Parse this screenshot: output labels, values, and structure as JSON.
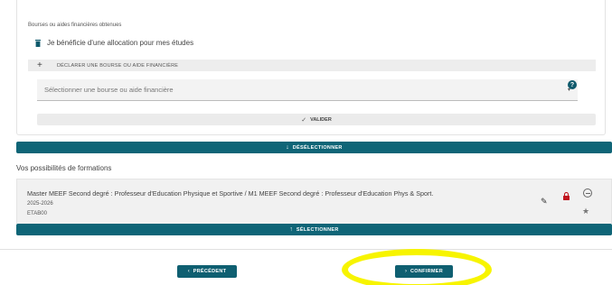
{
  "scholarship": {
    "section_label": "Bourses ou aides financières obtenues",
    "allocation_text": "Je bénéficie d'une allocation pour mes études",
    "declare_label": "DÉCLARER UNE BOURSE OU AIDE FINANCIÈRE",
    "select_placeholder": "Sélectionner une bourse ou aide financière",
    "validate_label": "VALIDER"
  },
  "deselect_label": "DÉSÉLECTIONNER",
  "possibilities": {
    "title": "Vos possibilités de formations",
    "formation": {
      "title": "Master MEEF Second degré : Professeur d'Education Physique et Sportive / M1 MEEF Second degré : Professeur d'Education Phys & Sport.",
      "year": "2025-2026",
      "etab": "ETAB00"
    },
    "select_label": "SÉLECTIONNER"
  },
  "nav": {
    "previous_label": "PRÉCÉDENT",
    "confirm_label": "CONFIRMER"
  },
  "icons": {
    "trash": "trash-icon",
    "plus": "+",
    "caret": "▾",
    "help": "?",
    "check": "✓",
    "arrow_down": "↓",
    "arrow_up": "↑",
    "pencil": "✎",
    "star": "★",
    "chevron_left": "‹",
    "chevron_right": "›"
  },
  "colors": {
    "primary": "#0f6577",
    "lock": "#c0161f",
    "highlight": "#f7f400"
  }
}
